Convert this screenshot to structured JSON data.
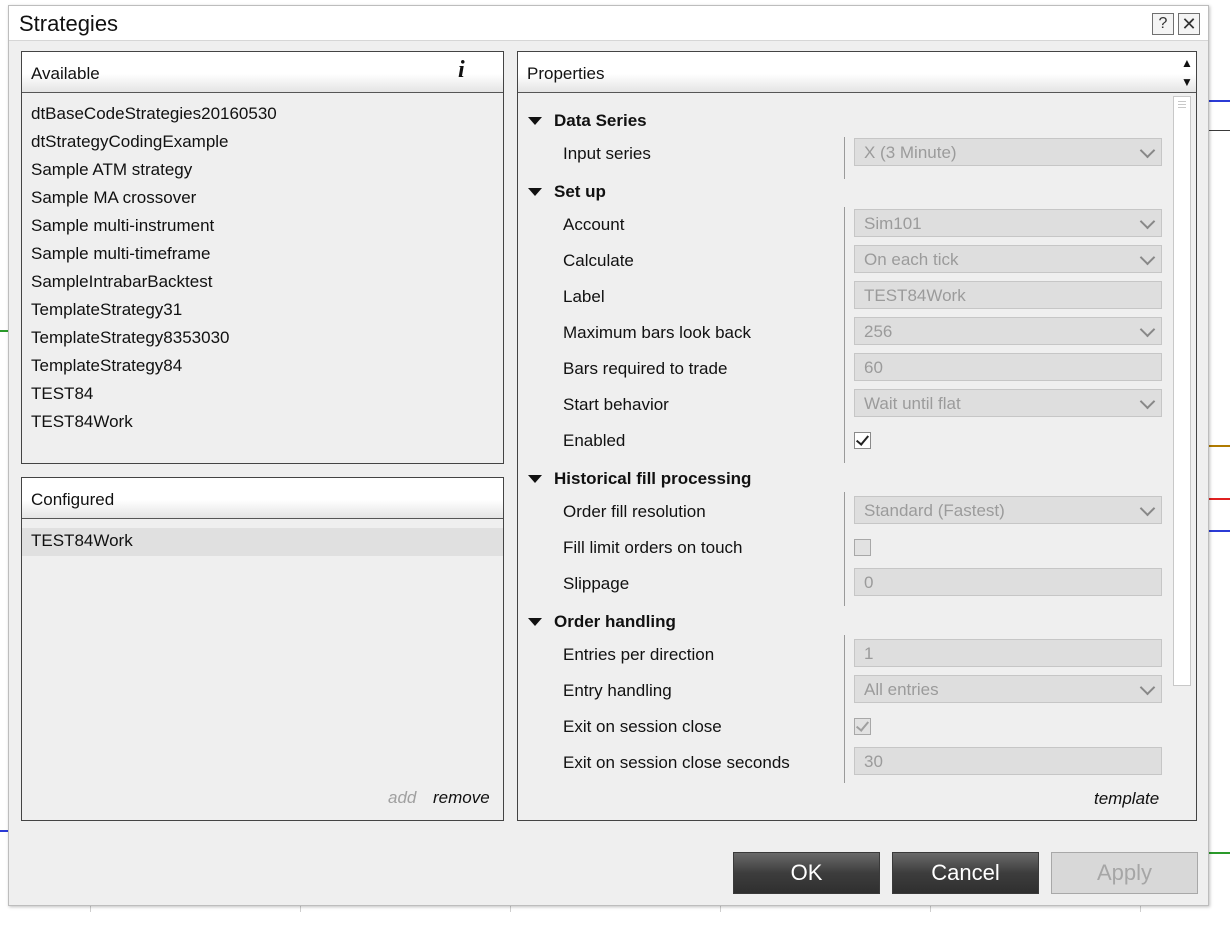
{
  "window": {
    "title": "Strategies",
    "help_label": "?",
    "close_label": "✕"
  },
  "available": {
    "header": "Available",
    "info_icon": "i",
    "items": [
      "dtBaseCodeStrategies20160530",
      "dtStrategyCodingExample",
      "Sample ATM strategy",
      "Sample MA crossover",
      "Sample multi-instrument",
      "Sample multi-timeframe",
      "SampleIntrabarBacktest",
      "TemplateStrategy31",
      "TemplateStrategy8353030",
      "TemplateStrategy84",
      "TEST84",
      "TEST84Work"
    ]
  },
  "configured": {
    "header": "Configured",
    "items": [
      "TEST84Work"
    ],
    "add_label": "add",
    "remove_label": "remove"
  },
  "properties": {
    "header": "Properties",
    "template_label": "template",
    "categories": {
      "data_series": {
        "label": "Data Series",
        "input_series": {
          "label": "Input series",
          "value": "X (3 Minute)"
        }
      },
      "set_up": {
        "label": "Set up",
        "account": {
          "label": "Account",
          "value": "Sim101"
        },
        "calculate": {
          "label": "Calculate",
          "value": "On each tick"
        },
        "label_field": {
          "label": "Label",
          "value": "TEST84Work"
        },
        "max_bars": {
          "label": "Maximum bars look back",
          "value": "256"
        },
        "bars_required": {
          "label": "Bars required to trade",
          "value": "60"
        },
        "start_behavior": {
          "label": "Start behavior",
          "value": "Wait until flat"
        },
        "enabled": {
          "label": "Enabled",
          "checked": true
        }
      },
      "historical_fill": {
        "label": "Historical fill processing",
        "order_fill_resolution": {
          "label": "Order fill resolution",
          "value": "Standard (Fastest)"
        },
        "fill_limit": {
          "label": "Fill limit orders on touch",
          "checked": false
        },
        "slippage": {
          "label": "Slippage",
          "value": "0"
        }
      },
      "order_handling": {
        "label": "Order handling",
        "entries_per_direction": {
          "label": "Entries per direction",
          "value": "1"
        },
        "entry_handling": {
          "label": "Entry handling",
          "value": "All entries"
        },
        "exit_on_close": {
          "label": "Exit on session close",
          "checked": true
        },
        "exit_seconds": {
          "label": "Exit on session close seconds",
          "value": "30"
        }
      }
    }
  },
  "buttons": {
    "ok": "OK",
    "cancel": "Cancel",
    "apply": "Apply"
  },
  "colors": {
    "dialog_bg": "#efefef",
    "button_dark": "#3d3d3d",
    "disabled_text": "#9b9b9b"
  }
}
